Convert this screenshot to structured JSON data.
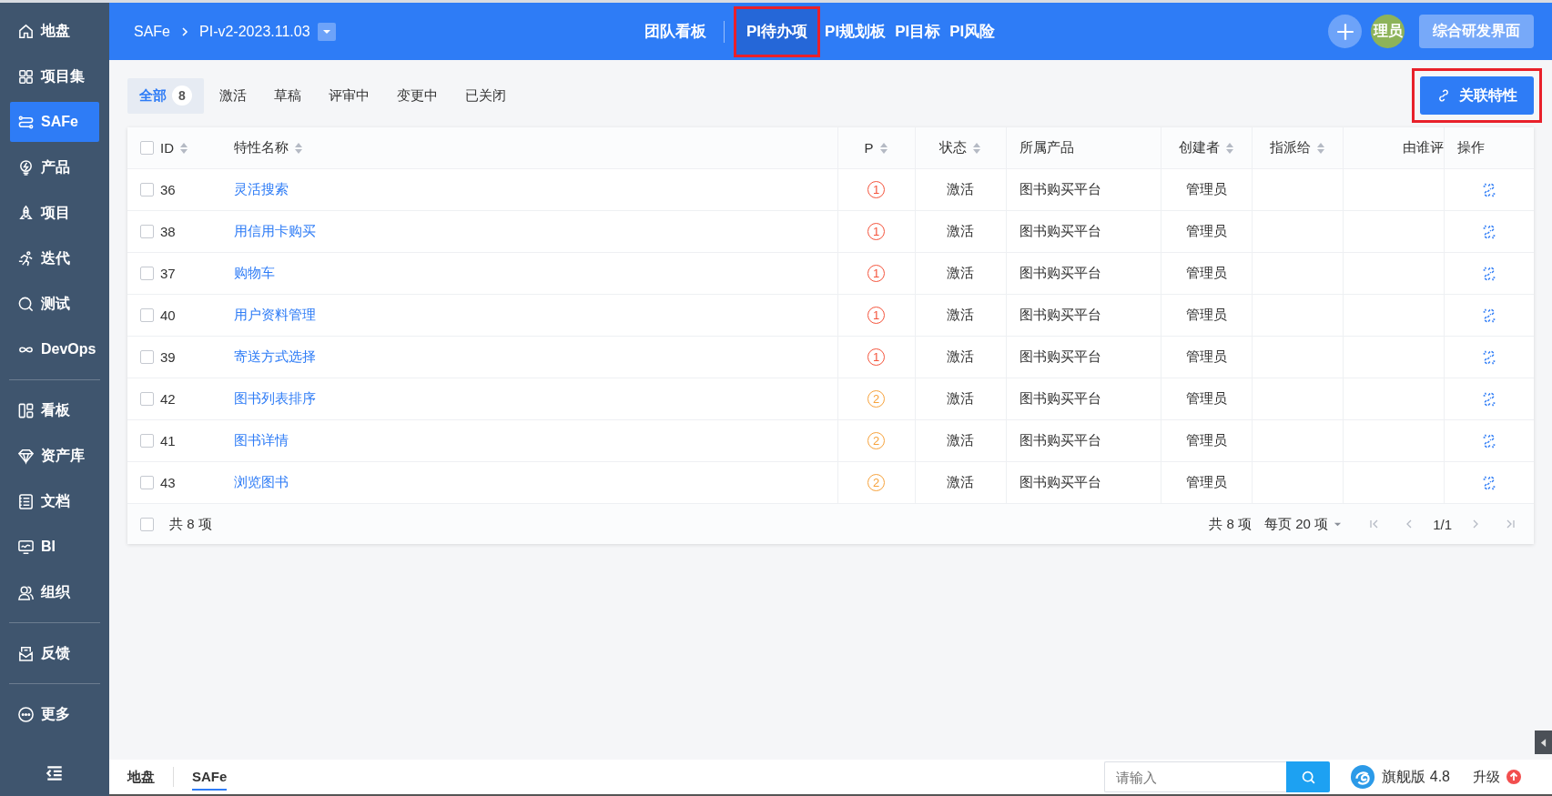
{
  "sidebar": {
    "groups": [
      [
        {
          "label": "地盘",
          "selected": false
        },
        {
          "label": "项目集",
          "selected": false
        },
        {
          "label": "SAFe",
          "selected": true
        },
        {
          "label": "产品",
          "selected": false
        },
        {
          "label": "项目",
          "selected": false
        },
        {
          "label": "迭代",
          "selected": false
        },
        {
          "label": "测试",
          "selected": false
        },
        {
          "label": "DevOps",
          "selected": false
        }
      ],
      [
        {
          "label": "看板",
          "selected": false
        },
        {
          "label": "资产库",
          "selected": false
        },
        {
          "label": "文档",
          "selected": false
        },
        {
          "label": "BI",
          "selected": false
        },
        {
          "label": "组织",
          "selected": false
        }
      ],
      [
        {
          "label": "反馈",
          "selected": false
        }
      ],
      [
        {
          "label": "更多",
          "selected": false
        }
      ]
    ]
  },
  "header": {
    "breadcrumb": [
      "SAFe",
      "PI-v2-2023.11.03"
    ],
    "nav": [
      {
        "label": "团队看板",
        "selected": false,
        "highlighted": false
      },
      {
        "label": "PI待办项",
        "selected": true,
        "highlighted": true
      },
      {
        "label": "PI规划板",
        "selected": false,
        "highlighted": false
      },
      {
        "label": "PI目标",
        "selected": false,
        "highlighted": false
      },
      {
        "label": "PI风险",
        "selected": false,
        "highlighted": false
      }
    ],
    "avatar": "理员",
    "switch_button": "综合研发界面"
  },
  "filters": [
    {
      "label": "全部",
      "count": "8",
      "selected": true
    },
    {
      "label": "激活",
      "selected": false
    },
    {
      "label": "草稿",
      "selected": false
    },
    {
      "label": "评审中",
      "selected": false
    },
    {
      "label": "变更中",
      "selected": false
    },
    {
      "label": "已关闭",
      "selected": false
    }
  ],
  "action_button": {
    "label": "关联特性",
    "highlighted": true
  },
  "table": {
    "columns": [
      {
        "label": "ID",
        "sortable": true
      },
      {
        "label": "特性名称",
        "sortable": true
      },
      {
        "label": "P",
        "sortable": true
      },
      {
        "label": "状态",
        "sortable": true
      },
      {
        "label": "所属产品",
        "sortable": false
      },
      {
        "label": "创建者",
        "sortable": true
      },
      {
        "label": "指派给",
        "sortable": true
      },
      {
        "label": "由谁评",
        "sortable": false
      },
      {
        "label": "操作",
        "sortable": false
      }
    ],
    "select_all_checked": false,
    "rows": [
      {
        "id": "36",
        "name": "灵活搜索",
        "priority": "1",
        "color": "#f5543c",
        "status": "激活",
        "product": "图书购买平台",
        "creator": "管理员",
        "checked": false
      },
      {
        "id": "38",
        "name": "用信用卡购买",
        "priority": "1",
        "color": "#f5543c",
        "status": "激活",
        "product": "图书购买平台",
        "creator": "管理员",
        "checked": false
      },
      {
        "id": "37",
        "name": "购物车",
        "priority": "1",
        "color": "#f5543c",
        "status": "激活",
        "product": "图书购买平台",
        "creator": "管理员",
        "checked": false
      },
      {
        "id": "40",
        "name": "用户资料管理",
        "priority": "1",
        "color": "#f5543c",
        "status": "激活",
        "product": "图书购买平台",
        "creator": "管理员",
        "checked": false
      },
      {
        "id": "39",
        "name": "寄送方式选择",
        "priority": "1",
        "color": "#f5543c",
        "status": "激活",
        "product": "图书购买平台",
        "creator": "管理员",
        "checked": false
      },
      {
        "id": "42",
        "name": "图书列表排序",
        "priority": "2",
        "color": "#f7a23b",
        "status": "激活",
        "product": "图书购买平台",
        "creator": "管理员",
        "checked": false
      },
      {
        "id": "41",
        "name": "图书详情",
        "priority": "2",
        "color": "#f7a23b",
        "status": "激活",
        "product": "图书购买平台",
        "creator": "管理员",
        "checked": false
      },
      {
        "id": "43",
        "name": "浏览图书",
        "priority": "2",
        "color": "#f7a23b",
        "status": "激活",
        "product": "图书购买平台",
        "creator": "管理员",
        "checked": false
      }
    ],
    "footer_checked": false,
    "footer_total": "共 8 项",
    "pager_total": "共 8 项",
    "page_size": "每页 20 项",
    "page": "1/1"
  },
  "bottom_bar": {
    "tabs": [
      {
        "label": "地盘",
        "selected": false
      },
      {
        "label": "SAFe",
        "selected": true
      }
    ],
    "search": {
      "placeholder": "请输入"
    },
    "edition": "旗舰版 4.8",
    "upgrade": "升级"
  }
}
